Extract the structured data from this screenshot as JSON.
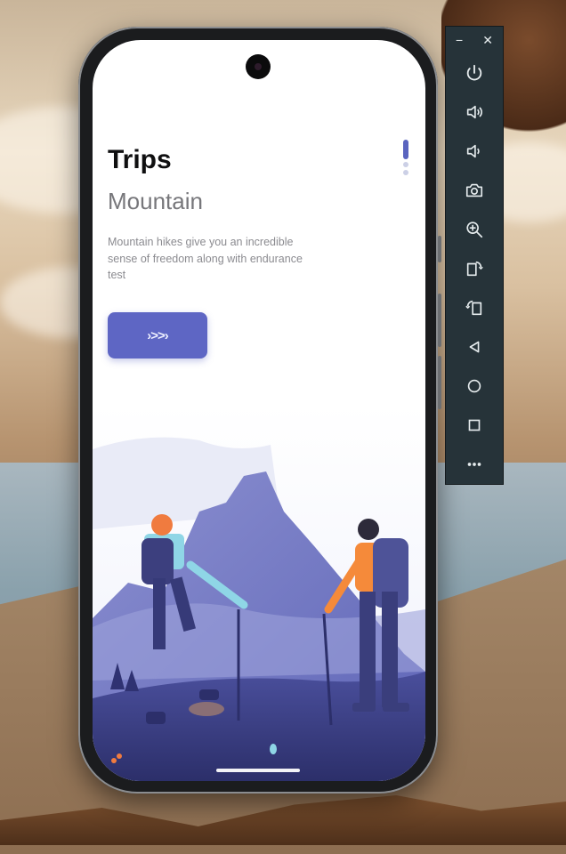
{
  "app": {
    "title": "Trips",
    "category": "Mountain",
    "description": "Mountain hikes give you an incredible sense of freedom along with endurance test",
    "next_button_label": "›>>›",
    "pagination": {
      "pages": 3,
      "current": 1
    }
  },
  "emulator_toolbar": {
    "window_controls": {
      "minimize": "−",
      "close": "✕"
    },
    "items": [
      {
        "icon": "power-icon"
      },
      {
        "icon": "volume-up-icon"
      },
      {
        "icon": "volume-down-icon"
      },
      {
        "icon": "camera-icon"
      },
      {
        "icon": "zoom-icon"
      },
      {
        "icon": "rotate-left-icon"
      },
      {
        "icon": "rotate-right-icon"
      },
      {
        "icon": "back-icon"
      },
      {
        "icon": "home-icon"
      },
      {
        "icon": "overview-icon"
      },
      {
        "icon": "more-icon"
      }
    ]
  },
  "colors": {
    "accent": "#5e66c4",
    "toolbar_bg": "#263339",
    "title": "#0f0f10",
    "subtitle": "#77777b"
  }
}
